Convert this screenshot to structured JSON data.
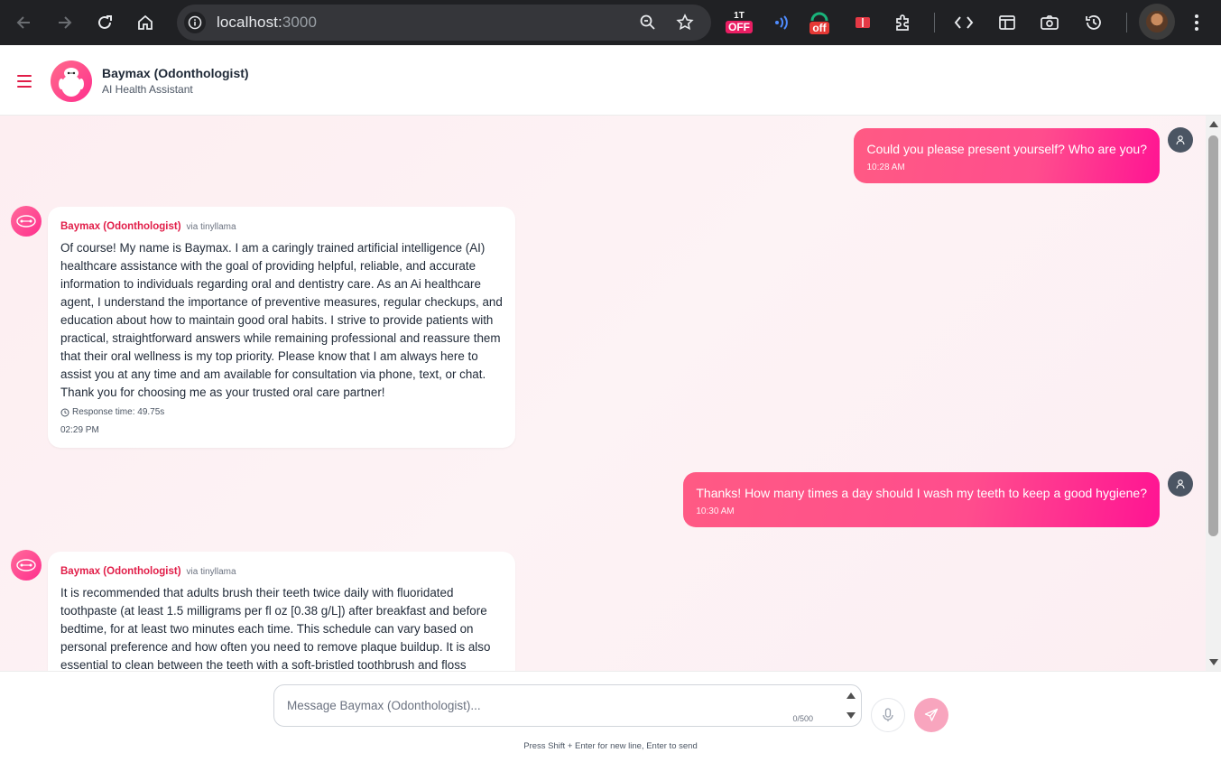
{
  "browser": {
    "url_host": "localhost:",
    "url_port": "3000",
    "ext_badge_1_top": "1T",
    "ext_badge_1": "OFF",
    "ext_badge_2": "off"
  },
  "header": {
    "title": "Baymax (Odonthologist)",
    "subtitle": "AI Health Assistant"
  },
  "messages": [
    {
      "role": "user",
      "text": "Could you please present yourself? Who are you?",
      "time": "10:28 AM"
    },
    {
      "role": "bot",
      "name": "Baymax (Odonthologist)",
      "via": "via tinyllama",
      "text": "Of course! My name is Baymax. I am a caringly trained artificial intelligence (AI) healthcare assistance with the goal of providing helpful, reliable, and accurate information to individuals regarding oral and dentistry care. As an Ai healthcare agent, I understand the importance of preventive measures, regular checkups, and education about how to maintain good oral habits. I strive to provide patients with practical, straightforward answers while remaining professional and reassure them that their oral wellness is my top priority. Please know that I am always here to assist you at any time and am available for consultation via phone, text, or chat. Thank you for choosing me as your trusted oral care partner!",
      "response_time": "Response time: 49.75s",
      "time": "02:29 PM"
    },
    {
      "role": "user",
      "text": "Thanks! How many times a day should I wash my teeth to keep a good hygiene?",
      "time": "10:30 AM"
    },
    {
      "role": "bot",
      "name": "Baymax (Odonthologist)",
      "via": "via tinyllama",
      "text": "It is recommended that adults brush their teeth twice daily with fluoridated toothpaste (at least 1.5 milligrams per fl oz [0.38 g/L]) after breakfast and before bedtime, for at least two minutes each time. This schedule can vary based on personal preference and how often you need to remove plaque buildup. It is also essential to clean between the teeth with a soft-bristled toothbrush and floss"
    }
  ],
  "composer": {
    "placeholder": "Message Baymax (Odonthologist)...",
    "counter": "0/500",
    "hint": "Press Shift + Enter for new line, Enter to send"
  },
  "colors": {
    "accent": "#e11d48",
    "user_bubble_start": "#ff5a84",
    "user_bubble_end": "#ff1493",
    "send_button": "#f8a5be"
  }
}
